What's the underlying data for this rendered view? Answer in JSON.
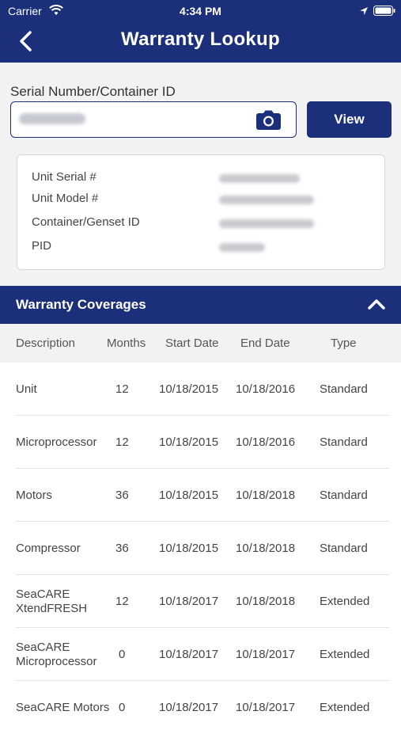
{
  "status": {
    "carrier": "Carrier",
    "time": "4:34 PM"
  },
  "header": {
    "title": "Warranty Lookup"
  },
  "search": {
    "label": "Serial Number/Container ID",
    "view_label": "View"
  },
  "info": [
    {
      "label": "Unit Serial #"
    },
    {
      "label": "Unit Model #"
    },
    {
      "label": "Container/Genset ID"
    },
    {
      "label": "PID"
    }
  ],
  "coverages": {
    "title": "Warranty Coverages",
    "columns": [
      "Description",
      "Months",
      "Start Date",
      "End Date",
      "Type"
    ],
    "rows": [
      {
        "description": "Unit",
        "months": "12",
        "start": "10/18/2015",
        "end": "10/18/2016",
        "type": "Standard"
      },
      {
        "description": "Microprocessor",
        "months": "12",
        "start": "10/18/2015",
        "end": "10/18/2016",
        "type": "Standard"
      },
      {
        "description": "Motors",
        "months": "36",
        "start": "10/18/2015",
        "end": "10/18/2018",
        "type": "Standard"
      },
      {
        "description": "Compressor",
        "months": "36",
        "start": "10/18/2015",
        "end": "10/18/2018",
        "type": "Standard"
      },
      {
        "description": "SeaCARE XtendFRESH",
        "months": "12",
        "start": "10/18/2017",
        "end": "10/18/2018",
        "type": "Extended"
      },
      {
        "description": "SeaCARE Microprocessor",
        "months": "0",
        "start": "10/18/2017",
        "end": "10/18/2017",
        "type": "Extended"
      },
      {
        "description": "SeaCARE Motors",
        "months": "0",
        "start": "10/18/2017",
        "end": "10/18/2017",
        "type": "Extended"
      }
    ]
  }
}
